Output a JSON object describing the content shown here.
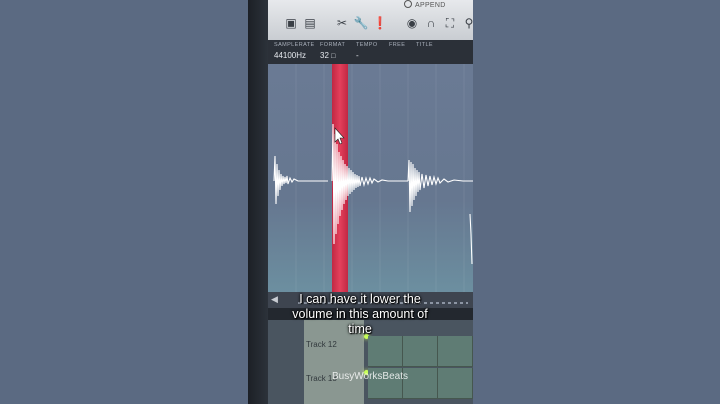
{
  "toolbar": {
    "append_label": "APPEND",
    "icons": [
      "save-icon",
      "file-icon",
      "scissors-icon",
      "wrench-icon",
      "pin-icon",
      "eye-icon",
      "magnet-icon",
      "fit-icon",
      "zoom-icon"
    ]
  },
  "info": {
    "samplerate_label": "SAMPLERATE",
    "samplerate_value": "44100Hz",
    "format_label": "FORMAT",
    "format_value": "32",
    "tempo_label": "TEMPO",
    "tempo_value": "-",
    "free_label": "FREE",
    "title_label": "TITLE"
  },
  "caption": {
    "line1": "I can have it lower the",
    "line2": "volume in this amount of",
    "line3": "time"
  },
  "playlist": {
    "track1": "Track 12",
    "track2": "Track 13"
  },
  "watermark": "BusyWorksBeats",
  "colors": {
    "selection": "#e8344f",
    "waveform": "#ffffff",
    "background": "#5b6a82"
  }
}
